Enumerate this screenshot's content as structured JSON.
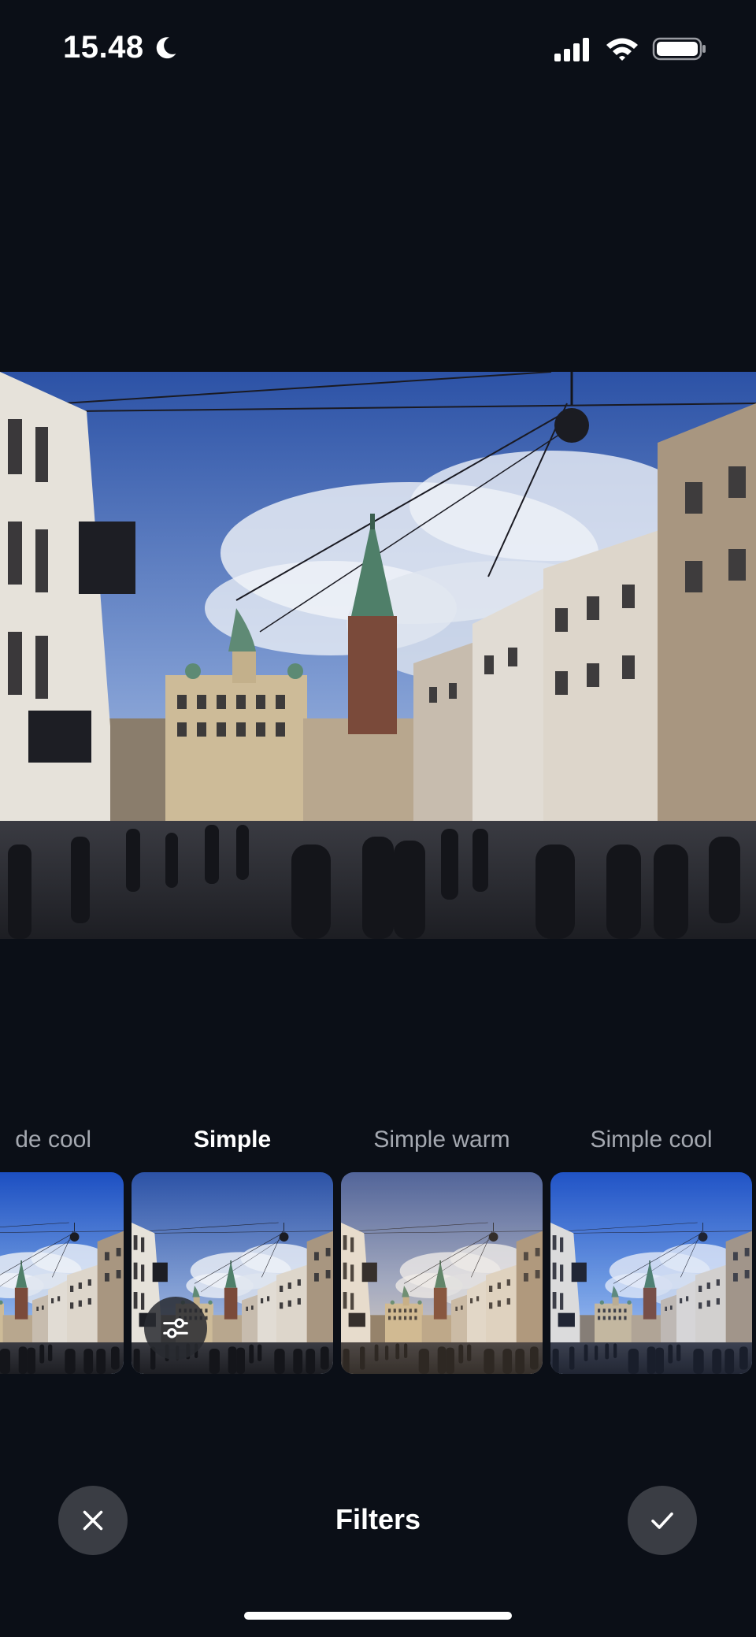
{
  "status_bar": {
    "time": "15.48",
    "icons": [
      "moon-icon",
      "cellular-signal-icon",
      "wifi-icon",
      "battery-icon"
    ]
  },
  "photo": {
    "description_icon": "edited-photo"
  },
  "filters": {
    "items": [
      {
        "label": "de cool",
        "selected": false
      },
      {
        "label": "Simple",
        "selected": true
      },
      {
        "label": "Simple warm",
        "selected": false
      },
      {
        "label": "Simple cool",
        "selected": false
      }
    ]
  },
  "bottom_bar": {
    "title": "Filters",
    "cancel_icon": "close-icon",
    "confirm_icon": "checkmark-icon"
  },
  "colors": {
    "background": "#0b0f17",
    "button_bg": "#3a3d44",
    "label_inactive": "#a4a8b0",
    "label_active": "#ffffff"
  }
}
